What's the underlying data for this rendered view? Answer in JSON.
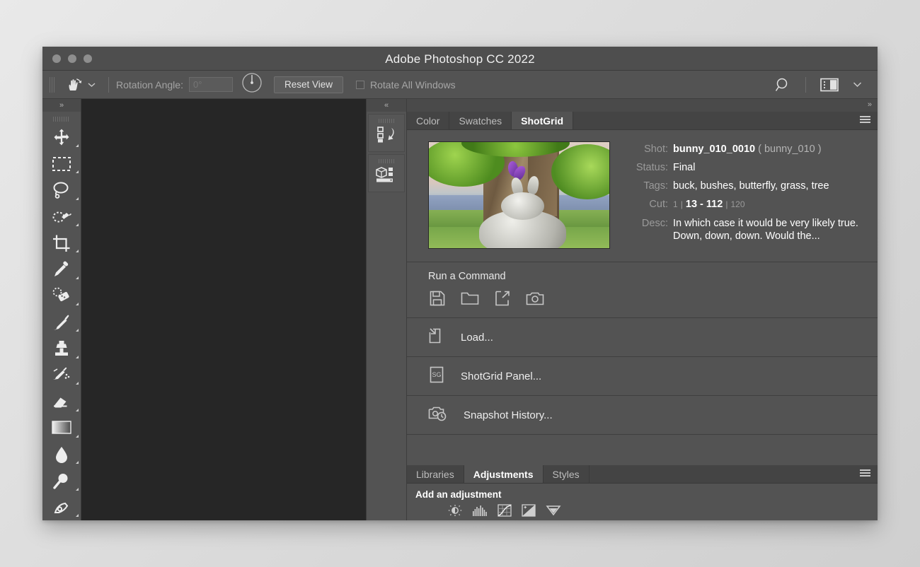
{
  "window": {
    "title": "Adobe Photoshop CC 2022",
    "traffic_lights": [
      "close-button",
      "minimize-button",
      "maximize-button"
    ]
  },
  "options_bar": {
    "tool_icon": "rotate-view-hand-icon",
    "tool_dropdown_icon": "chevron-down-icon",
    "rotation_label": "Rotation Angle:",
    "rotation_value": "",
    "rotation_placeholder": "0°",
    "dial_icon": "rotation-dial-icon",
    "reset_view_label": "Reset View",
    "rotate_all_label": "Rotate All Windows",
    "rotate_all_checked": false,
    "search_icon": "search-icon",
    "workspace_icon": "workspace-layout-icon",
    "workspace_chevron_icon": "chevron-down-icon"
  },
  "toolbar": {
    "expand_icon": "»",
    "tools": [
      {
        "name": "move-tool",
        "icon": "move-icon"
      },
      {
        "name": "rectangular-marquee-tool",
        "icon": "marquee-icon"
      },
      {
        "name": "lasso-tool",
        "icon": "lasso-icon"
      },
      {
        "name": "quick-selection-tool",
        "icon": "quick-selection-icon"
      },
      {
        "name": "crop-tool",
        "icon": "crop-icon"
      },
      {
        "name": "eyedropper-tool",
        "icon": "eyedropper-icon"
      },
      {
        "name": "healing-brush-tool",
        "icon": "healing-brush-icon"
      },
      {
        "name": "brush-tool",
        "icon": "brush-icon"
      },
      {
        "name": "clone-stamp-tool",
        "icon": "clone-stamp-icon"
      },
      {
        "name": "history-brush-tool",
        "icon": "history-brush-icon"
      },
      {
        "name": "eraser-tool",
        "icon": "eraser-icon"
      },
      {
        "name": "gradient-tool",
        "icon": "gradient-icon"
      },
      {
        "name": "blur-tool",
        "icon": "blur-droplet-icon"
      },
      {
        "name": "dodge-tool",
        "icon": "dodge-icon"
      },
      {
        "name": "pen-tool",
        "icon": "pen-icon"
      }
    ]
  },
  "icon_rail": {
    "collapse_icon": "«",
    "buttons": [
      {
        "name": "history-panel-button",
        "icon": "history-panel-icon"
      },
      {
        "name": "properties-panel-button",
        "icon": "properties-3d-panel-icon"
      }
    ]
  },
  "right_dock": {
    "expand_icon": "»",
    "menu_icon": "panel-menu-icon",
    "tabs": [
      {
        "label": "Color",
        "active": false
      },
      {
        "label": "Swatches",
        "active": false
      },
      {
        "label": "ShotGrid",
        "active": true
      }
    ],
    "shotgrid": {
      "thumbnail_alt": "shot-thumbnail",
      "fields": [
        {
          "key": "Shot:",
          "value": "bunny_010_0010",
          "suffix": "( bunny_010 )"
        },
        {
          "key": "Status:",
          "value": "Final"
        },
        {
          "key": "Tags:",
          "value": "buck, bushes, butterfly, grass, tree"
        }
      ],
      "cut": {
        "key": "Cut:",
        "in_handle": "1",
        "sep": "|",
        "range": "13 - 112",
        "duration": "120"
      },
      "desc": {
        "key": "Desc:",
        "value": "In which case it would be very likely true. Down, down, down. Would the..."
      },
      "run_command": {
        "title": "Run a Command",
        "icons": [
          {
            "name": "save-command-icon",
            "icon": "floppy-save-icon"
          },
          {
            "name": "open-command-icon",
            "icon": "folder-open-icon"
          },
          {
            "name": "publish-command-icon",
            "icon": "external-link-icon"
          },
          {
            "name": "snapshot-command-icon",
            "icon": "camera-icon"
          }
        ]
      },
      "commands": [
        {
          "label": "Load...",
          "icon": "load-document-icon",
          "name": "command-load"
        },
        {
          "label": "ShotGrid Panel...",
          "icon": "shotgrid-sg-icon",
          "name": "command-shotgrid-panel"
        },
        {
          "label": "Snapshot History...",
          "icon": "camera-clock-icon",
          "name": "command-snapshot-history"
        }
      ]
    },
    "bottom_dock": {
      "tabs": [
        {
          "label": "Libraries",
          "active": false
        },
        {
          "label": "Adjustments",
          "active": true
        },
        {
          "label": "Styles",
          "active": false
        }
      ],
      "menu_icon": "panel-menu-icon",
      "title": "Add an adjustment",
      "adjustment_icons": [
        {
          "name": "brightness-contrast-icon"
        },
        {
          "name": "levels-icon"
        },
        {
          "name": "curves-icon"
        },
        {
          "name": "exposure-icon"
        },
        {
          "name": "vibrance-icon"
        }
      ]
    }
  },
  "colors": {
    "panel_bg": "#535353",
    "canvas_bg": "#262626",
    "tab_inactive_bg": "#444444",
    "titlebar_bg": "#4e4e4e",
    "accent_text": "#ffffff",
    "muted_text": "#9a9a9a"
  }
}
